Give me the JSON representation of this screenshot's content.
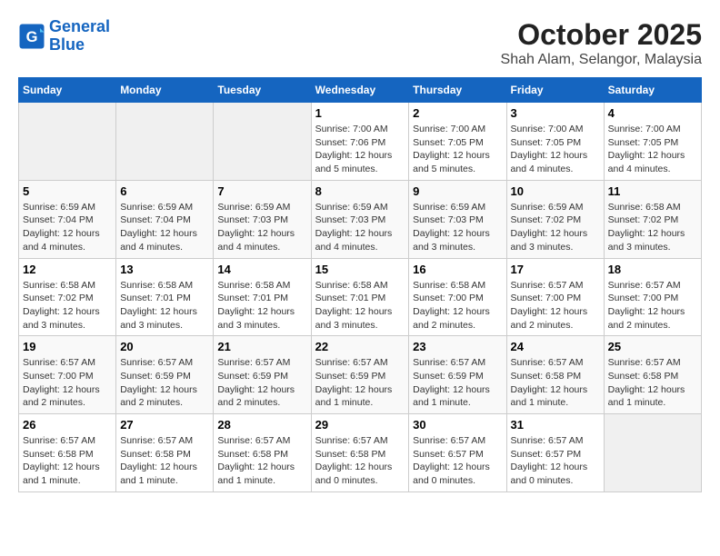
{
  "header": {
    "logo_line1": "General",
    "logo_line2": "Blue",
    "title": "October 2025",
    "subtitle": "Shah Alam, Selangor, Malaysia"
  },
  "weekdays": [
    "Sunday",
    "Monday",
    "Tuesday",
    "Wednesday",
    "Thursday",
    "Friday",
    "Saturday"
  ],
  "weeks": [
    [
      {
        "day": "",
        "sunrise": "",
        "sunset": "",
        "daylight": "",
        "empty": true
      },
      {
        "day": "",
        "sunrise": "",
        "sunset": "",
        "daylight": "",
        "empty": true
      },
      {
        "day": "",
        "sunrise": "",
        "sunset": "",
        "daylight": "",
        "empty": true
      },
      {
        "day": "1",
        "sunrise": "7:00 AM",
        "sunset": "7:06 PM",
        "daylight": "12 hours and 5 minutes."
      },
      {
        "day": "2",
        "sunrise": "7:00 AM",
        "sunset": "7:05 PM",
        "daylight": "12 hours and 5 minutes."
      },
      {
        "day": "3",
        "sunrise": "7:00 AM",
        "sunset": "7:05 PM",
        "daylight": "12 hours and 4 minutes."
      },
      {
        "day": "4",
        "sunrise": "7:00 AM",
        "sunset": "7:05 PM",
        "daylight": "12 hours and 4 minutes."
      }
    ],
    [
      {
        "day": "5",
        "sunrise": "6:59 AM",
        "sunset": "7:04 PM",
        "daylight": "12 hours and 4 minutes."
      },
      {
        "day": "6",
        "sunrise": "6:59 AM",
        "sunset": "7:04 PM",
        "daylight": "12 hours and 4 minutes."
      },
      {
        "day": "7",
        "sunrise": "6:59 AM",
        "sunset": "7:03 PM",
        "daylight": "12 hours and 4 minutes."
      },
      {
        "day": "8",
        "sunrise": "6:59 AM",
        "sunset": "7:03 PM",
        "daylight": "12 hours and 4 minutes."
      },
      {
        "day": "9",
        "sunrise": "6:59 AM",
        "sunset": "7:03 PM",
        "daylight": "12 hours and 3 minutes."
      },
      {
        "day": "10",
        "sunrise": "6:59 AM",
        "sunset": "7:02 PM",
        "daylight": "12 hours and 3 minutes."
      },
      {
        "day": "11",
        "sunrise": "6:58 AM",
        "sunset": "7:02 PM",
        "daylight": "12 hours and 3 minutes."
      }
    ],
    [
      {
        "day": "12",
        "sunrise": "6:58 AM",
        "sunset": "7:02 PM",
        "daylight": "12 hours and 3 minutes."
      },
      {
        "day": "13",
        "sunrise": "6:58 AM",
        "sunset": "7:01 PM",
        "daylight": "12 hours and 3 minutes."
      },
      {
        "day": "14",
        "sunrise": "6:58 AM",
        "sunset": "7:01 PM",
        "daylight": "12 hours and 3 minutes."
      },
      {
        "day": "15",
        "sunrise": "6:58 AM",
        "sunset": "7:01 PM",
        "daylight": "12 hours and 3 minutes."
      },
      {
        "day": "16",
        "sunrise": "6:58 AM",
        "sunset": "7:00 PM",
        "daylight": "12 hours and 2 minutes."
      },
      {
        "day": "17",
        "sunrise": "6:57 AM",
        "sunset": "7:00 PM",
        "daylight": "12 hours and 2 minutes."
      },
      {
        "day": "18",
        "sunrise": "6:57 AM",
        "sunset": "7:00 PM",
        "daylight": "12 hours and 2 minutes."
      }
    ],
    [
      {
        "day": "19",
        "sunrise": "6:57 AM",
        "sunset": "7:00 PM",
        "daylight": "12 hours and 2 minutes."
      },
      {
        "day": "20",
        "sunrise": "6:57 AM",
        "sunset": "6:59 PM",
        "daylight": "12 hours and 2 minutes."
      },
      {
        "day": "21",
        "sunrise": "6:57 AM",
        "sunset": "6:59 PM",
        "daylight": "12 hours and 2 minutes."
      },
      {
        "day": "22",
        "sunrise": "6:57 AM",
        "sunset": "6:59 PM",
        "daylight": "12 hours and 1 minute."
      },
      {
        "day": "23",
        "sunrise": "6:57 AM",
        "sunset": "6:59 PM",
        "daylight": "12 hours and 1 minute."
      },
      {
        "day": "24",
        "sunrise": "6:57 AM",
        "sunset": "6:58 PM",
        "daylight": "12 hours and 1 minute."
      },
      {
        "day": "25",
        "sunrise": "6:57 AM",
        "sunset": "6:58 PM",
        "daylight": "12 hours and 1 minute."
      }
    ],
    [
      {
        "day": "26",
        "sunrise": "6:57 AM",
        "sunset": "6:58 PM",
        "daylight": "12 hours and 1 minute."
      },
      {
        "day": "27",
        "sunrise": "6:57 AM",
        "sunset": "6:58 PM",
        "daylight": "12 hours and 1 minute."
      },
      {
        "day": "28",
        "sunrise": "6:57 AM",
        "sunset": "6:58 PM",
        "daylight": "12 hours and 1 minute."
      },
      {
        "day": "29",
        "sunrise": "6:57 AM",
        "sunset": "6:58 PM",
        "daylight": "12 hours and 0 minutes."
      },
      {
        "day": "30",
        "sunrise": "6:57 AM",
        "sunset": "6:57 PM",
        "daylight": "12 hours and 0 minutes."
      },
      {
        "day": "31",
        "sunrise": "6:57 AM",
        "sunset": "6:57 PM",
        "daylight": "12 hours and 0 minutes."
      },
      {
        "day": "",
        "sunrise": "",
        "sunset": "",
        "daylight": "",
        "empty": true
      }
    ]
  ],
  "labels": {
    "sunrise": "Sunrise:",
    "sunset": "Sunset:",
    "daylight": "Daylight:"
  }
}
